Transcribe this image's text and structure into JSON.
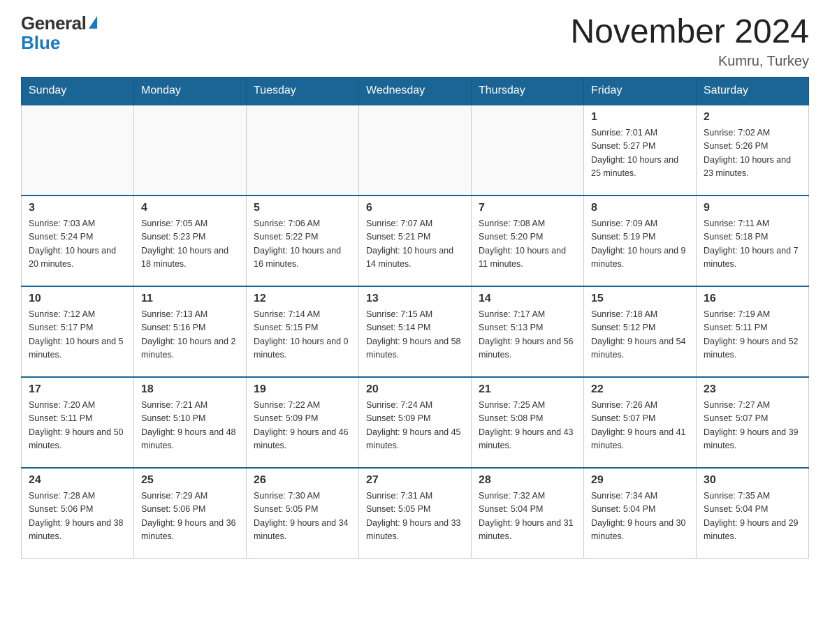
{
  "header": {
    "logo_general": "General",
    "logo_blue": "Blue",
    "main_title": "November 2024",
    "subtitle": "Kumru, Turkey"
  },
  "weekdays": [
    "Sunday",
    "Monday",
    "Tuesday",
    "Wednesday",
    "Thursday",
    "Friday",
    "Saturday"
  ],
  "weeks": [
    [
      {
        "day": "",
        "info": ""
      },
      {
        "day": "",
        "info": ""
      },
      {
        "day": "",
        "info": ""
      },
      {
        "day": "",
        "info": ""
      },
      {
        "day": "",
        "info": ""
      },
      {
        "day": "1",
        "info": "Sunrise: 7:01 AM\nSunset: 5:27 PM\nDaylight: 10 hours and 25 minutes."
      },
      {
        "day": "2",
        "info": "Sunrise: 7:02 AM\nSunset: 5:26 PM\nDaylight: 10 hours and 23 minutes."
      }
    ],
    [
      {
        "day": "3",
        "info": "Sunrise: 7:03 AM\nSunset: 5:24 PM\nDaylight: 10 hours and 20 minutes."
      },
      {
        "day": "4",
        "info": "Sunrise: 7:05 AM\nSunset: 5:23 PM\nDaylight: 10 hours and 18 minutes."
      },
      {
        "day": "5",
        "info": "Sunrise: 7:06 AM\nSunset: 5:22 PM\nDaylight: 10 hours and 16 minutes."
      },
      {
        "day": "6",
        "info": "Sunrise: 7:07 AM\nSunset: 5:21 PM\nDaylight: 10 hours and 14 minutes."
      },
      {
        "day": "7",
        "info": "Sunrise: 7:08 AM\nSunset: 5:20 PM\nDaylight: 10 hours and 11 minutes."
      },
      {
        "day": "8",
        "info": "Sunrise: 7:09 AM\nSunset: 5:19 PM\nDaylight: 10 hours and 9 minutes."
      },
      {
        "day": "9",
        "info": "Sunrise: 7:11 AM\nSunset: 5:18 PM\nDaylight: 10 hours and 7 minutes."
      }
    ],
    [
      {
        "day": "10",
        "info": "Sunrise: 7:12 AM\nSunset: 5:17 PM\nDaylight: 10 hours and 5 minutes."
      },
      {
        "day": "11",
        "info": "Sunrise: 7:13 AM\nSunset: 5:16 PM\nDaylight: 10 hours and 2 minutes."
      },
      {
        "day": "12",
        "info": "Sunrise: 7:14 AM\nSunset: 5:15 PM\nDaylight: 10 hours and 0 minutes."
      },
      {
        "day": "13",
        "info": "Sunrise: 7:15 AM\nSunset: 5:14 PM\nDaylight: 9 hours and 58 minutes."
      },
      {
        "day": "14",
        "info": "Sunrise: 7:17 AM\nSunset: 5:13 PM\nDaylight: 9 hours and 56 minutes."
      },
      {
        "day": "15",
        "info": "Sunrise: 7:18 AM\nSunset: 5:12 PM\nDaylight: 9 hours and 54 minutes."
      },
      {
        "day": "16",
        "info": "Sunrise: 7:19 AM\nSunset: 5:11 PM\nDaylight: 9 hours and 52 minutes."
      }
    ],
    [
      {
        "day": "17",
        "info": "Sunrise: 7:20 AM\nSunset: 5:11 PM\nDaylight: 9 hours and 50 minutes."
      },
      {
        "day": "18",
        "info": "Sunrise: 7:21 AM\nSunset: 5:10 PM\nDaylight: 9 hours and 48 minutes."
      },
      {
        "day": "19",
        "info": "Sunrise: 7:22 AM\nSunset: 5:09 PM\nDaylight: 9 hours and 46 minutes."
      },
      {
        "day": "20",
        "info": "Sunrise: 7:24 AM\nSunset: 5:09 PM\nDaylight: 9 hours and 45 minutes."
      },
      {
        "day": "21",
        "info": "Sunrise: 7:25 AM\nSunset: 5:08 PM\nDaylight: 9 hours and 43 minutes."
      },
      {
        "day": "22",
        "info": "Sunrise: 7:26 AM\nSunset: 5:07 PM\nDaylight: 9 hours and 41 minutes."
      },
      {
        "day": "23",
        "info": "Sunrise: 7:27 AM\nSunset: 5:07 PM\nDaylight: 9 hours and 39 minutes."
      }
    ],
    [
      {
        "day": "24",
        "info": "Sunrise: 7:28 AM\nSunset: 5:06 PM\nDaylight: 9 hours and 38 minutes."
      },
      {
        "day": "25",
        "info": "Sunrise: 7:29 AM\nSunset: 5:06 PM\nDaylight: 9 hours and 36 minutes."
      },
      {
        "day": "26",
        "info": "Sunrise: 7:30 AM\nSunset: 5:05 PM\nDaylight: 9 hours and 34 minutes."
      },
      {
        "day": "27",
        "info": "Sunrise: 7:31 AM\nSunset: 5:05 PM\nDaylight: 9 hours and 33 minutes."
      },
      {
        "day": "28",
        "info": "Sunrise: 7:32 AM\nSunset: 5:04 PM\nDaylight: 9 hours and 31 minutes."
      },
      {
        "day": "29",
        "info": "Sunrise: 7:34 AM\nSunset: 5:04 PM\nDaylight: 9 hours and 30 minutes."
      },
      {
        "day": "30",
        "info": "Sunrise: 7:35 AM\nSunset: 5:04 PM\nDaylight: 9 hours and 29 minutes."
      }
    ]
  ]
}
